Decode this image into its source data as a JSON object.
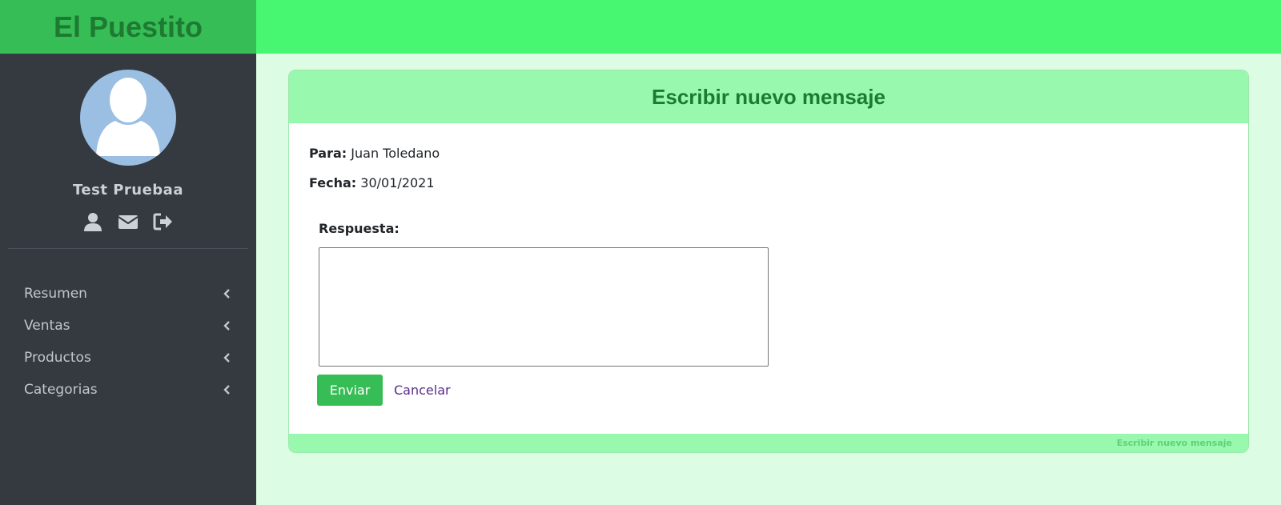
{
  "app": {
    "brand": "El Puestito"
  },
  "user": {
    "name": "Test Pruebaa"
  },
  "sidebar": {
    "items": [
      {
        "label": "Resumen"
      },
      {
        "label": "Ventas"
      },
      {
        "label": "Productos"
      },
      {
        "label": "Categorias"
      }
    ]
  },
  "card": {
    "title": "Escribir nuevo mensaje",
    "to_label": "Para:",
    "to_value": "Juan Toledano",
    "date_label": "Fecha:",
    "date_value": "30/01/2021",
    "reply_label": "Respuesta:",
    "reply_value": "",
    "send_label": "Enviar",
    "cancel_label": "Cancelar",
    "footer_text": "Escribir nuevo mensaje"
  },
  "colors": {
    "brand_bg": "#37bd55",
    "topbar_bg": "#47f772",
    "sidebar_bg": "#343a40",
    "card_header_bg": "#98f8ad",
    "page_bg": "#ddfce4"
  }
}
